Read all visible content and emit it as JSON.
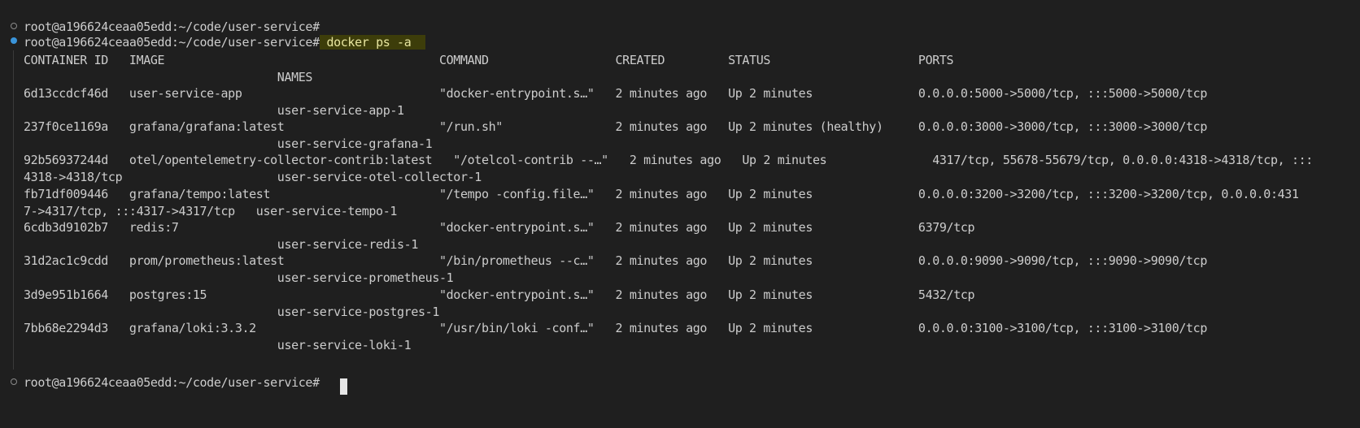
{
  "terminal": {
    "prompt": "root@a196624ceaa05edd:~/code/user-service#",
    "command": "docker ps -a",
    "header": {
      "line1": "CONTAINER ID   IMAGE                                       COMMAND                  CREATED         STATUS                     PORTS",
      "line2": "                                    NAMES"
    },
    "rows": [
      {
        "line1": "6d13ccdcf46d   user-service-app                            \"docker-entrypoint.s…\"   2 minutes ago   Up 2 minutes               0.0.0.0:5000->5000/tcp, :::5000->5000/tcp",
        "line2": "                                    user-service-app-1"
      },
      {
        "line1": "237f0ce1169a   grafana/grafana:latest                      \"/run.sh\"                2 minutes ago   Up 2 minutes (healthy)     0.0.0.0:3000->3000/tcp, :::3000->3000/tcp",
        "line2": "                                    user-service-grafana-1"
      },
      {
        "line1": "92b56937244d   otel/opentelemetry-collector-contrib:latest   \"/otelcol-contrib --…\"   2 minutes ago   Up 2 minutes               4317/tcp, 55678-55679/tcp, 0.0.0.0:4318->4318/tcp, :::",
        "line2": "4318->4318/tcp                      user-service-otel-collector-1"
      },
      {
        "line1": "fb71df009446   grafana/tempo:latest                        \"/tempo -config.file…\"   2 minutes ago   Up 2 minutes               0.0.0.0:3200->3200/tcp, :::3200->3200/tcp, 0.0.0.0:431",
        "line2": "7->4317/tcp, :::4317->4317/tcp   user-service-tempo-1"
      },
      {
        "line1": "6cdb3d9102b7   redis:7                                     \"docker-entrypoint.s…\"   2 minutes ago   Up 2 minutes               6379/tcp",
        "line2": "                                    user-service-redis-1"
      },
      {
        "line1": "31d2ac1c9cdd   prom/prometheus:latest                      \"/bin/prometheus --c…\"   2 minutes ago   Up 2 minutes               0.0.0.0:9090->9090/tcp, :::9090->9090/tcp",
        "line2": "                                    user-service-prometheus-1"
      },
      {
        "line1": "3d9e951b1664   postgres:15                                 \"docker-entrypoint.s…\"   2 minutes ago   Up 2 minutes               5432/tcp",
        "line2": "                                    user-service-postgres-1"
      },
      {
        "line1": "7bb68e2294d3   grafana/loki:3.3.2                          \"/usr/bin/loki -conf…\"   2 minutes ago   Up 2 minutes               0.0.0.0:3100->3100/tcp, :::3100->3100/tcp",
        "line2": "                                    user-service-loki-1"
      }
    ]
  },
  "colors": {
    "background": "#1f1f1f",
    "text": "#cccccc",
    "command_highlight": "#3d3d0a",
    "gutter_filled": "#3a94d9"
  }
}
